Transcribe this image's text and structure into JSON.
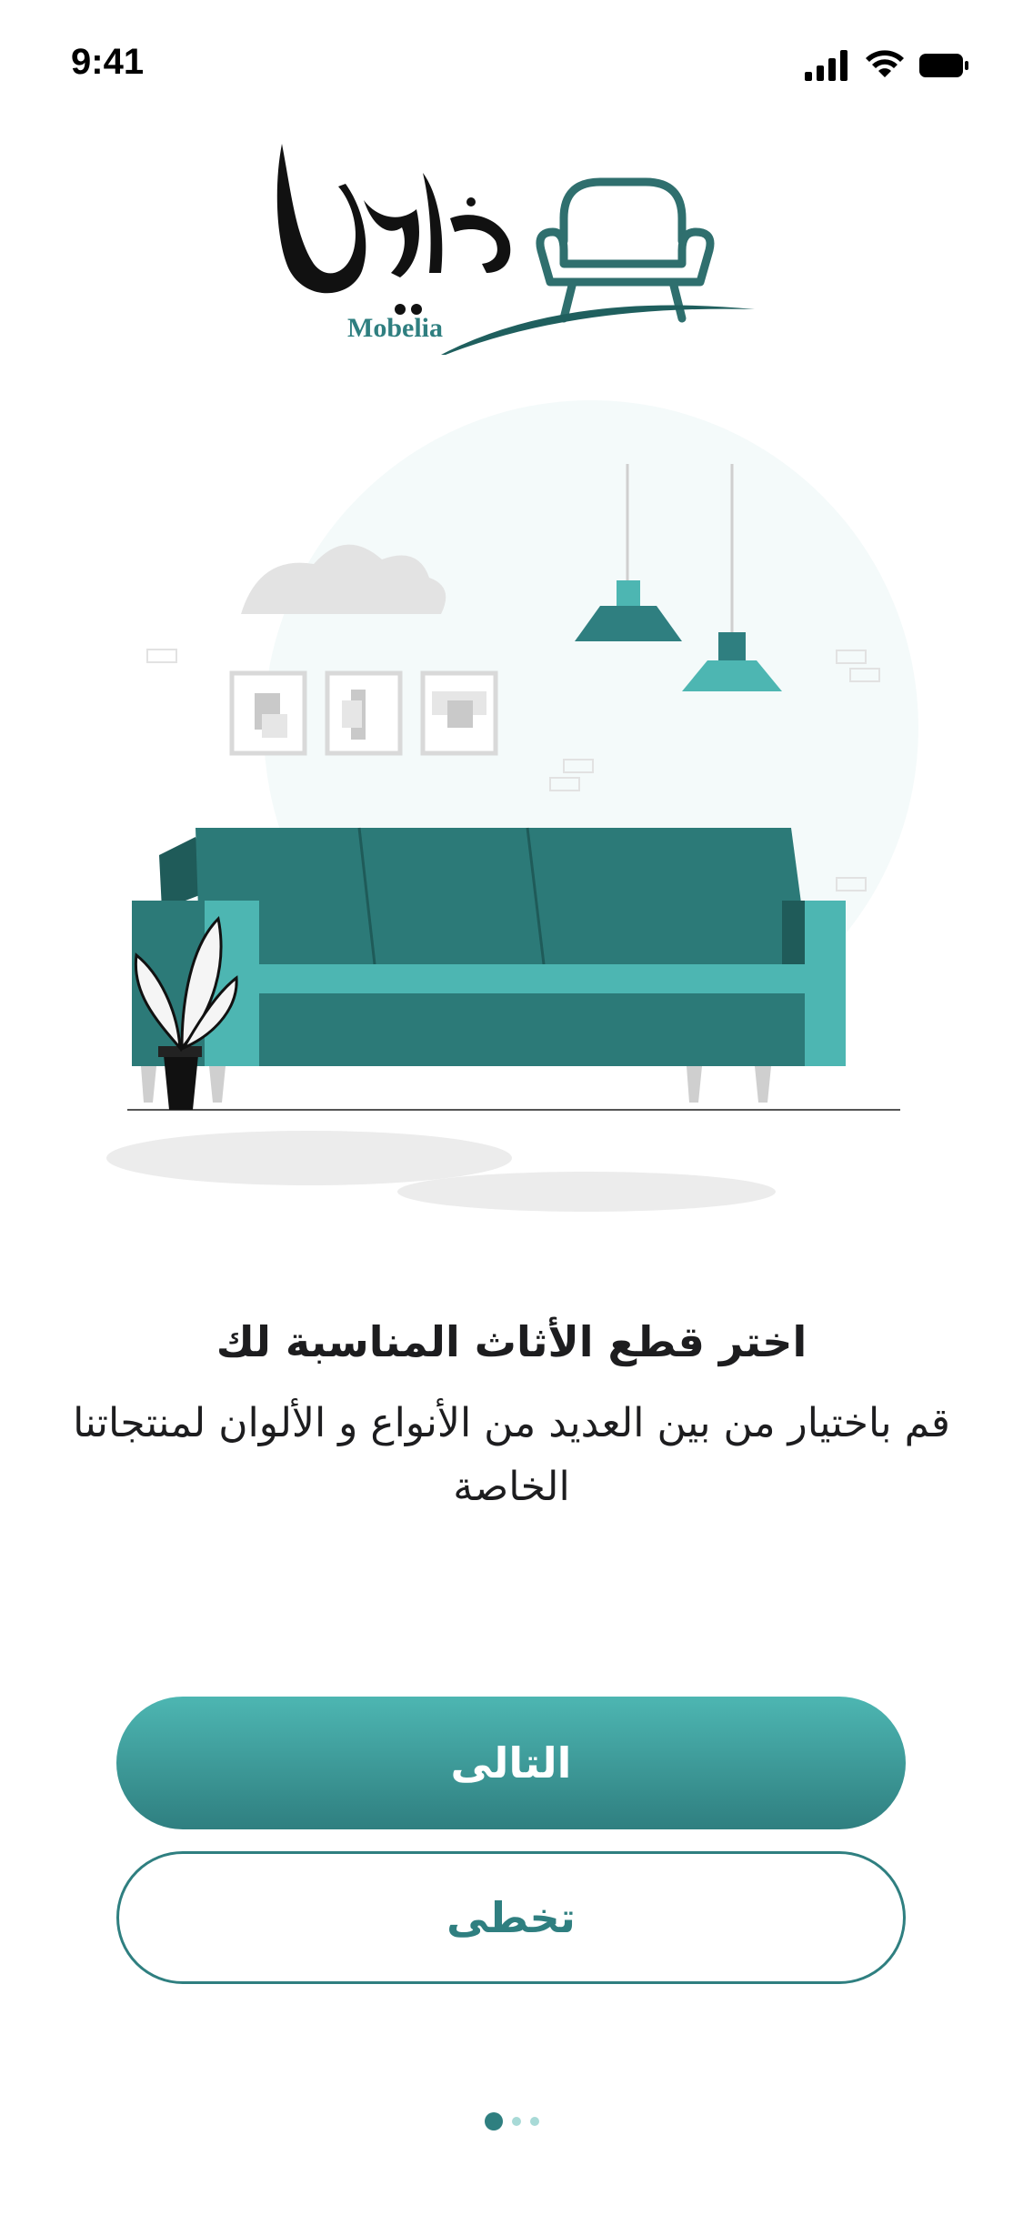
{
  "status_bar": {
    "time": "9:41",
    "icons": [
      "signal-icon",
      "wifi-icon",
      "battery-icon"
    ]
  },
  "logo": {
    "arabic_wordmark": "موبليا",
    "latin_wordmark": "Mobelia",
    "icon": "armchair-icon"
  },
  "illustration": {
    "icons": [
      "sofa-icon",
      "pendant-lamp-icon",
      "picture-frame-icon",
      "plant-icon",
      "cloud-icon"
    ]
  },
  "onboarding": {
    "title": "اختر قطع الأثاث المناسبة لك",
    "subtitle": "قم باختيار من بين العديد من الأنواع و الألوان لمنتجاتنا الخاصة"
  },
  "buttons": {
    "next_label": "التالى",
    "skip_label": "تخطى"
  },
  "pagination": {
    "current_page": 1,
    "total_pages": 3
  },
  "colors": {
    "primary": "#2f7f80",
    "primary_light": "#4db6b2",
    "dot_inactive": "#a8dad7",
    "text": "#1d1d1f"
  }
}
